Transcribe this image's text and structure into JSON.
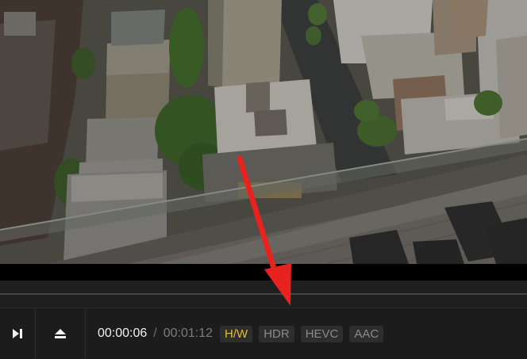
{
  "player": {
    "current_time": "00:00:06",
    "separator": "/",
    "total_time": "00:01:12",
    "badges": {
      "hw": "H/W",
      "hdr": "HDR",
      "hevc": "HEVC",
      "aac": "AAC"
    }
  },
  "icons": {
    "next": "skip-next-icon",
    "eject": "eject-icon"
  },
  "colors": {
    "active_badge": "#e2bf2d",
    "inactive_badge": "#8a8a8a",
    "annotation_arrow": "#e8231f"
  }
}
